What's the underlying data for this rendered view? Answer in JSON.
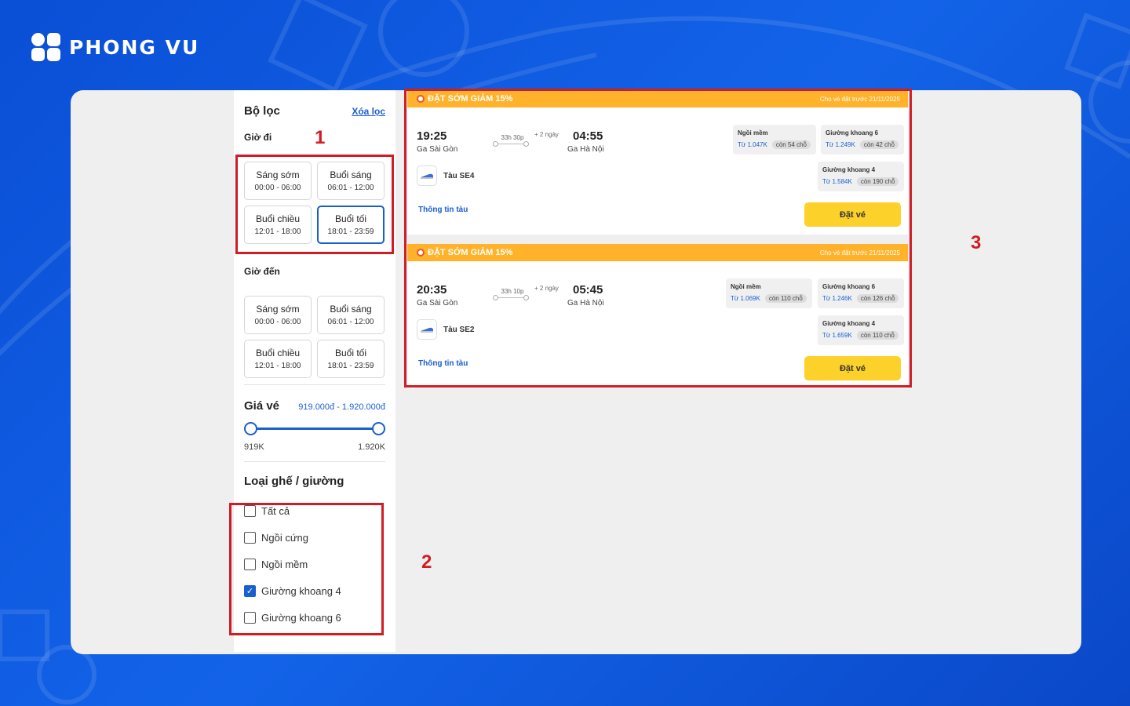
{
  "brand": {
    "name": "PHONG VU"
  },
  "filters": {
    "title": "Bộ lọc",
    "clear_label": "Xóa lọc",
    "departure_label": "Giờ đi",
    "departure_slots": [
      {
        "label": "Sáng sớm",
        "range": "00:00 - 06:00",
        "active": false
      },
      {
        "label": "Buổi sáng",
        "range": "06:01 - 12:00",
        "active": false
      },
      {
        "label": "Buổi chiều",
        "range": "12:01 - 18:00",
        "active": false
      },
      {
        "label": "Buổi tối",
        "range": "18:01 - 23:59",
        "active": true
      }
    ],
    "arrival_label": "Giờ đến",
    "arrival_slots": [
      {
        "label": "Sáng sớm",
        "range": "00:00 - 06:00",
        "active": false
      },
      {
        "label": "Buổi sáng",
        "range": "06:01 - 12:00",
        "active": false
      },
      {
        "label": "Buổi chiều",
        "range": "12:01 - 18:00",
        "active": false
      },
      {
        "label": "Buổi tối",
        "range": "18:01 - 23:59",
        "active": false
      }
    ],
    "price_title": "Giá vé",
    "price_range": "919.000đ - 1.920.000đ",
    "price_min": "919K",
    "price_max": "1.920K",
    "seat_title": "Loại ghế / giường",
    "seat_options": [
      {
        "label": "Tất cả",
        "checked": false
      },
      {
        "label": "Ngồi cứng",
        "checked": false
      },
      {
        "label": "Ngồi mềm",
        "checked": false
      },
      {
        "label": "Giường khoang 4",
        "checked": true
      },
      {
        "label": "Giường khoang 6",
        "checked": false
      }
    ]
  },
  "trips": [
    {
      "promo": "ĐẶT SỚM GIẢM 15%",
      "promo_note": "Cho vé đặt trước 21/11/2025",
      "dep_time": "19:25",
      "dep_station": "Ga Sài Gòn",
      "duration": "33h 30p",
      "days": "+ 2 ngày",
      "arr_time": "04:55",
      "arr_station": "Ga Hà Nội",
      "train": "Tàu SE4",
      "info_label": "Thông tin tàu",
      "book_label": "Đặt vé",
      "seats": [
        {
          "name": "Ngồi mềm",
          "price": "Từ 1.047K",
          "left": "còn 54 chỗ"
        },
        {
          "name": "Giường khoang 6",
          "price": "Từ 1.249K",
          "left": "còn 42 chỗ"
        },
        {
          "name": "Giường khoang 4",
          "price": "Từ 1.584K",
          "left": "còn 190 chỗ"
        }
      ]
    },
    {
      "promo": "ĐẶT SỚM GIẢM 15%",
      "promo_note": "Cho vé đặt trước 21/11/2025",
      "dep_time": "20:35",
      "dep_station": "Ga Sài Gòn",
      "duration": "33h 10p",
      "days": "+ 2 ngày",
      "arr_time": "05:45",
      "arr_station": "Ga Hà Nội",
      "train": "Tàu SE2",
      "info_label": "Thông tin tàu",
      "book_label": "Đặt vé",
      "seats": [
        {
          "name": "Ngồi mềm",
          "price": "Từ 1.069K",
          "left": "còn 110 chỗ"
        },
        {
          "name": "Giường khoang 6",
          "price": "Từ 1.246K",
          "left": "còn 126 chỗ"
        },
        {
          "name": "Giường khoang 4",
          "price": "Từ 1.659K",
          "left": "còn 110 chỗ"
        }
      ]
    }
  ],
  "annotations": [
    "1",
    "2",
    "3"
  ],
  "colors": {
    "accent": "#1a5fd0",
    "promo": "#ffb22a",
    "book": "#fcd12a",
    "annotation": "#d01c24"
  }
}
